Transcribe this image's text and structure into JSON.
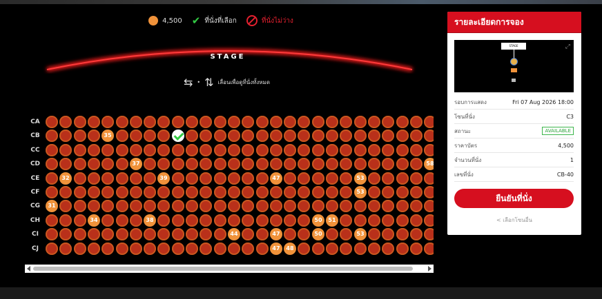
{
  "legend": {
    "price": "4,500",
    "selected": "ที่นั่งที่เลือก",
    "unavailable": "ที่นั่งไม่ว่าง",
    "colors": {
      "available": "#f0923a",
      "sold": "#b9301a",
      "selected_check": "#33cc44",
      "unavailable": "#e5202f"
    }
  },
  "stage": {
    "label": "STAGE"
  },
  "hint": {
    "text": "เลื่อนเพื่อดูที่นั่งทั้งหมด"
  },
  "seatmap": {
    "rows": [
      {
        "label": "CA",
        "seats": []
      },
      {
        "label": "CB",
        "seats": [
          {
            "col": 4,
            "num": "35",
            "state": "avail"
          },
          {
            "col": 9,
            "num": "",
            "state": "sel"
          }
        ]
      },
      {
        "label": "CC",
        "seats": []
      },
      {
        "label": "CD",
        "seats": [
          {
            "col": 6,
            "num": "37",
            "state": "avail"
          },
          {
            "col": 27,
            "num": "58",
            "state": "avail"
          }
        ]
      },
      {
        "label": "CE",
        "seats": [
          {
            "col": 1,
            "num": "32",
            "state": "avail"
          },
          {
            "col": 8,
            "num": "39",
            "state": "avail"
          },
          {
            "col": 16,
            "num": "47",
            "state": "avail"
          },
          {
            "col": 22,
            "num": "53",
            "state": "avail"
          }
        ]
      },
      {
        "label": "CF",
        "seats": [
          {
            "col": 22,
            "num": "53",
            "state": "avail"
          }
        ]
      },
      {
        "label": "CG",
        "seats": [
          {
            "col": 0,
            "num": "31",
            "state": "avail"
          }
        ]
      },
      {
        "label": "CH",
        "seats": [
          {
            "col": 3,
            "num": "34",
            "state": "avail"
          },
          {
            "col": 7,
            "num": "38",
            "state": "avail"
          },
          {
            "col": 19,
            "num": "50",
            "state": "avail"
          },
          {
            "col": 20,
            "num": "51",
            "state": "avail"
          }
        ]
      },
      {
        "label": "CI",
        "seats": [
          {
            "col": 13,
            "num": "44",
            "state": "avail"
          },
          {
            "col": 16,
            "num": "47",
            "state": "avail"
          },
          {
            "col": 19,
            "num": "50",
            "state": "avail"
          },
          {
            "col": 22,
            "num": "53",
            "state": "avail"
          }
        ]
      },
      {
        "label": "CJ",
        "seats": [
          {
            "col": 16,
            "num": "47",
            "state": "avail"
          },
          {
            "col": 17,
            "num": "48",
            "state": "avail"
          }
        ]
      }
    ]
  },
  "panel": {
    "title": "รายละเอียดการจอง",
    "mini_stage": "STAGE",
    "details": [
      {
        "key": "รอบการแสดง",
        "value": "Fri 07 Aug 2026 18:00"
      },
      {
        "key": "โซนที่นั่ง",
        "value": "C3"
      },
      {
        "key": "สถานะ",
        "value": "AVAILABLE"
      },
      {
        "key": "ราคาบัตร",
        "value": "4,500"
      },
      {
        "key": "จำนวนที่นั่ง",
        "value": "1"
      },
      {
        "key": "เลขที่นั่ง",
        "value": "CB-40"
      }
    ],
    "confirm_label": "ยืนยันที่นั่ง",
    "back_label": "< เลือกโซนอื่น"
  }
}
